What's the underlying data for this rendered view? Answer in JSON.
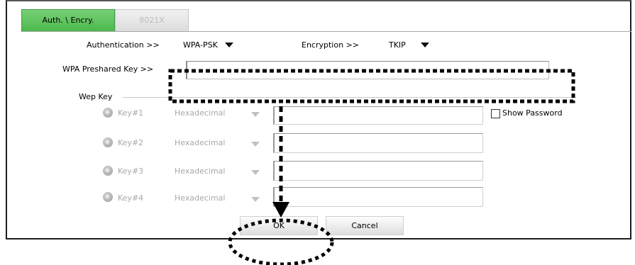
{
  "tabs": {
    "active": "Auth. \\ Encry.",
    "inactive": "8021X"
  },
  "auth": {
    "label": "Authentication >>",
    "value": "WPA-PSK"
  },
  "encryption": {
    "label": "Encryption >>",
    "value": "TKIP"
  },
  "wpa": {
    "label": "WPA Preshared Key >>",
    "value": ""
  },
  "wep": {
    "section_label": "Wep Key",
    "keys": [
      {
        "label": "Key#1",
        "format": "Hexadecimal"
      },
      {
        "label": "Key#2",
        "format": "Hexadecimal"
      },
      {
        "label": "Key#3",
        "format": "Hexadecimal"
      },
      {
        "label": "Key#4",
        "format": "Hexadecimal"
      }
    ],
    "show_password": "Show Password"
  },
  "buttons": {
    "ok": "OK",
    "cancel": "Cancel"
  },
  "colors": {
    "tab_active": "#4cb84c",
    "disabled_text": "#a8a8a8",
    "annotation": "#000000"
  }
}
